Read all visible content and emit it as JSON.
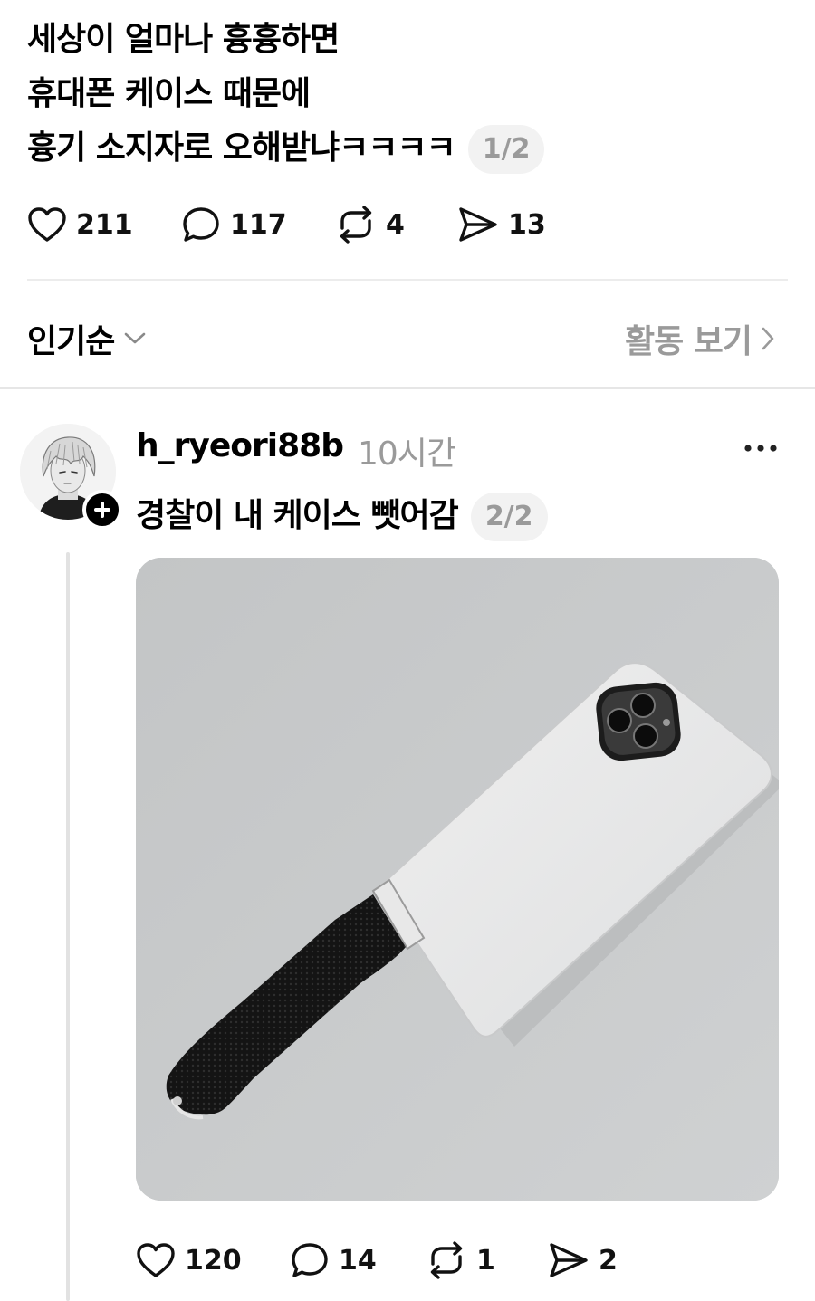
{
  "post": {
    "lines": [
      "세상이 얼마나 흉흉하면",
      "휴대폰 케이스 때문에",
      "흉기 소지자로 오해받냐ㅋㅋㅋㅋ"
    ],
    "page_indicator": "1/2",
    "likes": "211",
    "comments": "117",
    "reposts": "4",
    "shares": "13"
  },
  "sort": {
    "label": "인기순",
    "activity_label": "활동 보기"
  },
  "reply": {
    "username": "h_ryeori88b",
    "time": "10시간",
    "text": "경찰이 내 케이스 뺏어감",
    "page_indicator": "2/2",
    "likes": "120",
    "comments": "14",
    "reposts": "1",
    "shares": "2"
  },
  "icons": {
    "like": "heart-icon",
    "comment": "comment-bubble-icon",
    "repost": "repost-icon",
    "share": "send-icon",
    "more": "more-dots-icon",
    "follow": "plus-icon"
  }
}
